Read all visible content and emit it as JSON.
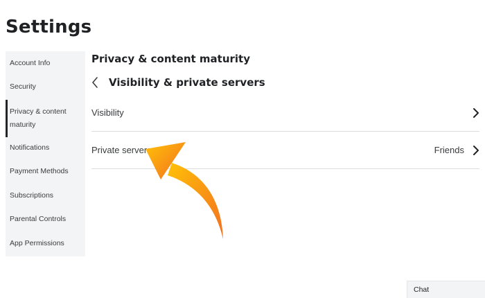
{
  "page": {
    "title": "Settings"
  },
  "sidebar": {
    "items": [
      {
        "label": "Account Info",
        "active": false
      },
      {
        "label": "Security",
        "active": false
      },
      {
        "label": "Privacy & content maturity",
        "active": true
      },
      {
        "label": "Notifications",
        "active": false
      },
      {
        "label": "Payment Methods",
        "active": false
      },
      {
        "label": "Subscriptions",
        "active": false
      },
      {
        "label": "Parental Controls",
        "active": false
      },
      {
        "label": "App Permissions",
        "active": false
      }
    ]
  },
  "main": {
    "section_title": "Privacy & content maturity",
    "subsection_title": "Visibility & private servers",
    "rows": [
      {
        "label": "Visibility",
        "value": ""
      },
      {
        "label": "Private servers",
        "value": "Friends"
      }
    ]
  },
  "chat": {
    "label": "Chat"
  },
  "colors": {
    "arrow_gradient_start": "#ffc107",
    "arrow_gradient_end": "#f36f21",
    "sidebar_bg": "#f2f4f5",
    "active_indicator": "#232527"
  },
  "icons": {
    "back": "chevron-left-icon",
    "row_chevron": "chevron-right-icon",
    "annotation": "curved-arrow-icon"
  }
}
